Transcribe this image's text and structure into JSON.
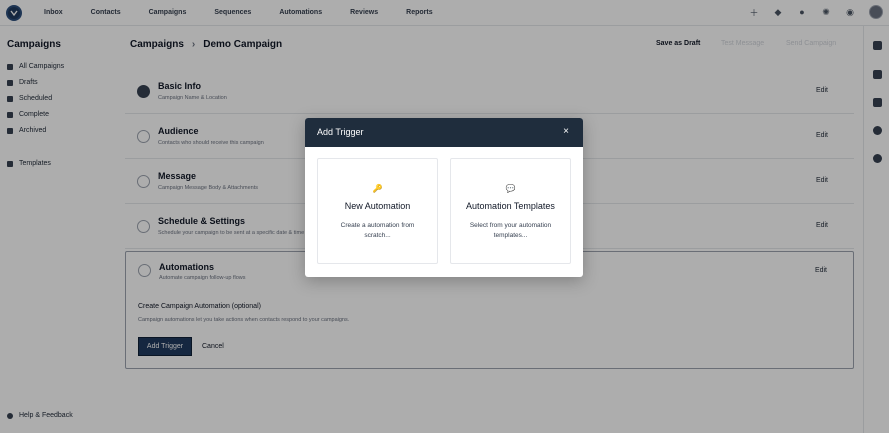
{
  "nav": {
    "items": [
      "Inbox",
      "Contacts",
      "Campaigns",
      "Sequences",
      "Automations",
      "Reviews",
      "Reports"
    ]
  },
  "top_icons": [
    "plus-icon",
    "megaphone-icon",
    "help-icon",
    "gear-icon",
    "bell-icon"
  ],
  "sidebar": {
    "title": "Campaigns",
    "items": [
      "All Campaigns",
      "Drafts",
      "Scheduled",
      "Complete",
      "Archived"
    ],
    "templates": "Templates",
    "help": "Help & Feedback"
  },
  "header": {
    "breadcrumb_root": "Campaigns",
    "breadcrumb_current": "Demo Campaign",
    "save_draft": "Save as Draft",
    "send_test": "Test Message",
    "send_campaign": "Send Campaign"
  },
  "steps": [
    {
      "title": "Basic Info",
      "sub": "Campaign Name & Location",
      "edit": "Edit"
    },
    {
      "title": "Audience",
      "sub": "Contacts who should receive this campaign",
      "edit": "Edit"
    },
    {
      "title": "Message",
      "sub": "Campaign Message Body & Attachments",
      "edit": "Edit"
    },
    {
      "title": "Schedule & Settings",
      "sub": "Schedule your campaign to be sent at a specific date & time",
      "edit": "Edit"
    },
    {
      "title": "Automations",
      "sub": "Automate campaign follow-up flows",
      "edit": "Edit"
    }
  ],
  "automation": {
    "label": "Create Campaign Automation (optional)",
    "description": "Campaign automations let you take actions when contacts respond to your campaigns.",
    "add_trigger": "Add Trigger",
    "cancel": "Cancel"
  },
  "modal": {
    "title": "Add Trigger",
    "close": "×",
    "cards": [
      {
        "icon": "key-icon",
        "glyph": "🔑",
        "title": "New Automation",
        "desc": "Create a automation from scratch..."
      },
      {
        "icon": "chat-bubble-icon",
        "glyph": "💬",
        "title": "Automation Templates",
        "desc": "Select from your automation templates..."
      }
    ]
  }
}
